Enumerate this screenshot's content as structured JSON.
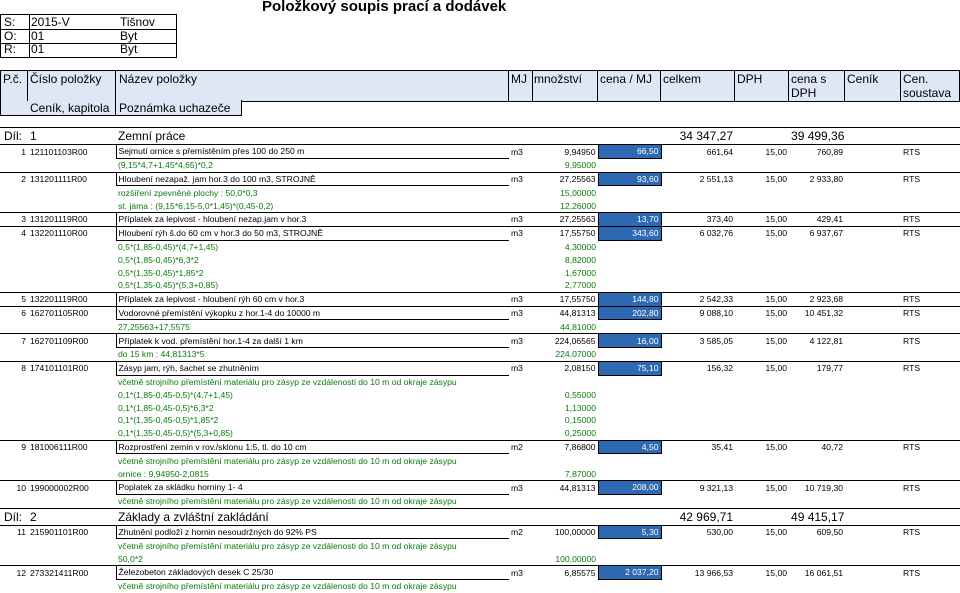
{
  "title": "Položkový soupis prací a dodávek",
  "meta": [
    {
      "label": "S:",
      "code": "2015-V",
      "name": "Tišnov"
    },
    {
      "label": "O:",
      "code": "01",
      "name": "Byt"
    },
    {
      "label": "R:",
      "code": "01",
      "name": "Byt"
    }
  ],
  "header": {
    "pc": "P.č.",
    "cislo": "Číslo položky",
    "nazev": "Název položky",
    "mj": "MJ",
    "mnozstvi": "množství",
    "cena_mj": "cena / MJ",
    "celkem": "celkem",
    "dph": "DPH",
    "cena_s_dph_1": "cena s",
    "cena_s_dph_2": "DPH",
    "cenik": "Ceník",
    "cen_soustava_1": "Cen.",
    "cen_soustava_2": "soustava",
    "cenik_kapitola": "Ceník, kapitola",
    "poznamka": "Poznámka uchazeče"
  },
  "rows": [
    {
      "kind": "dil",
      "label": "Díl:",
      "num": "1",
      "name": "Zemní práce",
      "celkem": "34 347,27",
      "cena_dph": "39 499,36"
    },
    {
      "kind": "item",
      "pc": "1",
      "code": "121101103R00",
      "name": "Sejmutí ornice s přemístěním přes 100 do 250 m",
      "mj": "m3",
      "qty": "9,94950",
      "price": "66,50",
      "total": "661,64",
      "dph": "15,00",
      "withdph": "760,89",
      "sys": "RTS"
    },
    {
      "kind": "sub",
      "text": "(9,15*4,7+1,45*4,65)*0,2",
      "qty": "9,95000"
    },
    {
      "kind": "item",
      "pc": "2",
      "code": "131201111R00",
      "name": "Hloubení nezapaž. jam hor.3 do 100 m3, STROJNĚ",
      "mj": "m3",
      "qty": "27,25563",
      "price": "93,60",
      "total": "2 551,13",
      "dph": "15,00",
      "withdph": "2 933,80",
      "sys": "RTS"
    },
    {
      "kind": "sub",
      "text": "rozšíření zpevněné plochy : 50,0*0,3",
      "qty": "15,00000"
    },
    {
      "kind": "sub",
      "text": "st. jáma : (9,15*6,15-5,0*1,45)*(0,45-0,2)",
      "qty": "12,26000"
    },
    {
      "kind": "item",
      "pc": "3",
      "code": "131201119R00",
      "name": "Příplatek za lepivost - hloubení nezap.jam v hor.3",
      "mj": "m3",
      "qty": "27,25563",
      "price": "13,70",
      "total": "373,40",
      "dph": "15,00",
      "withdph": "429,41",
      "sys": "RTS"
    },
    {
      "kind": "item",
      "pc": "4",
      "code": "132201110R00",
      "name": "Hloubení rýh š.do 60 cm v hor.3 do 50 m3, STROJNĚ",
      "mj": "m3",
      "qty": "17,55750",
      "price": "343,60",
      "total": "6 032,76",
      "dph": "15,00",
      "withdph": "6 937,67",
      "sys": "RTS"
    },
    {
      "kind": "sub",
      "text": "0,5*(1,85-0,45)*(4,7+1,45)",
      "qty": "4,30000"
    },
    {
      "kind": "sub",
      "text": "0,5*(1,85-0,45)*6,3*2",
      "qty": "8,82000"
    },
    {
      "kind": "sub",
      "text": "0,5*(1,35-0,45)*1,85*2",
      "qty": "1,67000"
    },
    {
      "kind": "sub",
      "text": "0,5*(1,35-0,45)*(5,3+0,85)",
      "qty": "2,77000"
    },
    {
      "kind": "item",
      "pc": "5",
      "code": "132201119R00",
      "name": "Příplatek za lepivost - hloubení rýh 60 cm v hor.3",
      "mj": "m3",
      "qty": "17,55750",
      "price": "144,80",
      "total": "2 542,33",
      "dph": "15,00",
      "withdph": "2 923,68",
      "sys": "RTS"
    },
    {
      "kind": "item",
      "pc": "6",
      "code": "162701105R00",
      "name": "Vodorovné přemístění výkopku z hor.1-4 do 10000 m",
      "mj": "m3",
      "qty": "44,81313",
      "price": "202,80",
      "total": "9 088,10",
      "dph": "15,00",
      "withdph": "10 451,32",
      "sys": "RTS"
    },
    {
      "kind": "sub",
      "text": "27,25563+17,5575",
      "qty": "44,81000"
    },
    {
      "kind": "item",
      "pc": "7",
      "code": "162701109R00",
      "name": "Příplatek k vod. přemístění hor.1-4 za další 1 km",
      "mj": "m3",
      "qty": "224,06565",
      "price": "16,00",
      "total": "3 585,05",
      "dph": "15,00",
      "withdph": "4 122,81",
      "sys": "RTS"
    },
    {
      "kind": "sub",
      "text": "do 15 km : 44,81313*5",
      "qty": "224,07000"
    },
    {
      "kind": "item",
      "pc": "8",
      "code": "174101101R00",
      "name": "Zásyp jam, rýh, šachet se zhutněním",
      "mj": "m3",
      "qty": "2,08150",
      "price": "75,10",
      "total": "156,32",
      "dph": "15,00",
      "withdph": "179,77",
      "sys": "RTS"
    },
    {
      "kind": "note",
      "text": "včetně strojního přemístění materiálu pro zásyp ze vzdálenosti do 10 m od okraje zásypu"
    },
    {
      "kind": "sub",
      "text": "0,1*(1,85-0,45-0,5)*(4,7+1,45)",
      "qty": "0,55000"
    },
    {
      "kind": "sub",
      "text": "0,1*(1,85-0,45-0,5)*6,3*2",
      "qty": "1,13000"
    },
    {
      "kind": "sub",
      "text": "0,1*(1,35-0,45-0,5)*1,85*2",
      "qty": "0,15000"
    },
    {
      "kind": "sub",
      "text": "0,1*(1,35-0,45-0,5)*(5,3+0,85)",
      "qty": "0,25000"
    },
    {
      "kind": "item",
      "pc": "9",
      "code": "181006111R00",
      "name": "Rozprostření zemin v rov./sklonu 1:5, tl. do 10 cm",
      "mj": "m2",
      "qty": "7,86800",
      "price": "4,50",
      "total": "35,41",
      "dph": "15,00",
      "withdph": "40,72",
      "sys": "RTS"
    },
    {
      "kind": "note",
      "text": "včetně strojního přemístění materiálu pro zásyp ze vzdálenosti do 10 m od okraje zásypu"
    },
    {
      "kind": "sub",
      "text": "ornice : 9,94950-2,0815",
      "qty": "7,87000"
    },
    {
      "kind": "item",
      "pc": "10",
      "code": "199000002R00",
      "name": "Poplatek za skládku horniny 1- 4",
      "mj": "m3",
      "qty": "44,81313",
      "price": "208,00",
      "total": "9 321,13",
      "dph": "15,00",
      "withdph": "10 719,30",
      "sys": "RTS"
    },
    {
      "kind": "note",
      "text": "včetně strojního přemístění materiálu pro zásyp ze vzdálenosti do 10 m od okraje zásypu"
    },
    {
      "kind": "dil",
      "label": "Díl:",
      "num": "2",
      "name": "Základy a zvláštní zakládání",
      "celkem": "42 969,71",
      "cena_dph": "49 415,17"
    },
    {
      "kind": "item",
      "pc": "11",
      "code": "215901101R00",
      "name": "Zhutnění podloží z hornin nesoudržných do 92% PS",
      "mj": "m2",
      "qty": "100,00000",
      "price": "5,30",
      "total": "530,00",
      "dph": "15,00",
      "withdph": "609,50",
      "sys": "RTS"
    },
    {
      "kind": "note",
      "text": "včetně strojního přemístění materiálu pro zásyp ze vzdálenosti do 10 m od okraje zásypu"
    },
    {
      "kind": "sub",
      "text": "50,0*2",
      "qty": "100,00000"
    },
    {
      "kind": "item",
      "pc": "12",
      "code": "273321411R00",
      "name": "Železobeton základových desek C 25/30",
      "mj": "m3",
      "qty": "6,85575",
      "price": "2 037,20",
      "total": "13 966,53",
      "dph": "15,00",
      "withdph": "16 061,51",
      "sys": "RTS"
    },
    {
      "kind": "note",
      "text": "včetně strojního přemístění materiálu pro zásyp ze vzdálenosti do 10 m od okraje zásypu"
    }
  ]
}
